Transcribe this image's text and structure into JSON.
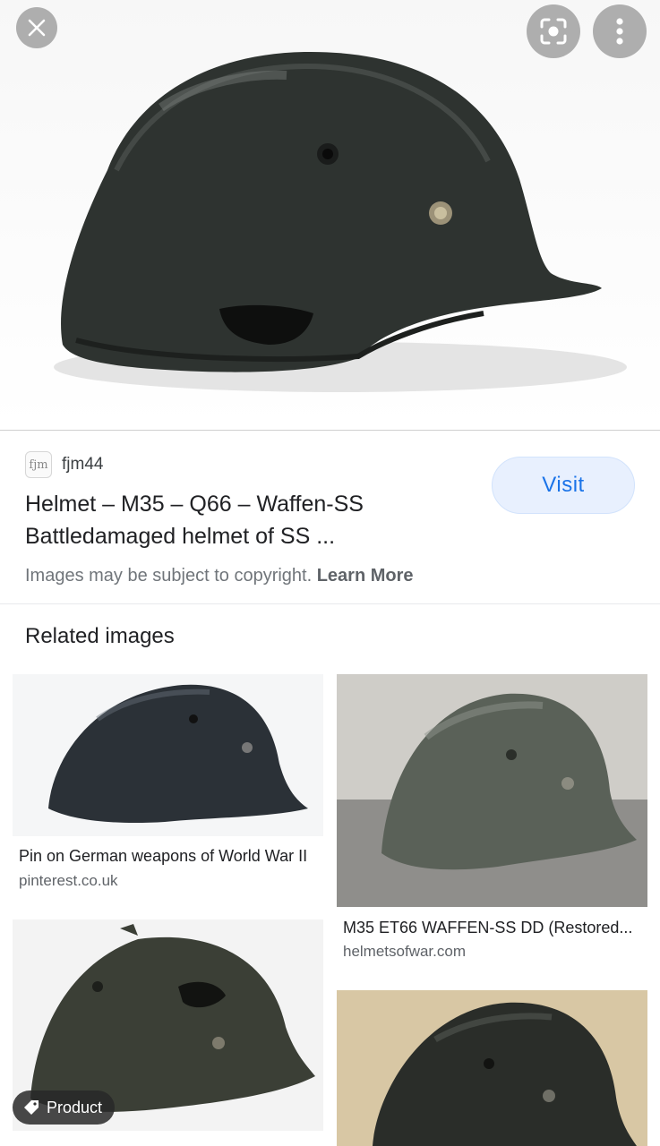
{
  "hero": {
    "colors": {
      "background": "#f7f7f7",
      "helmet": "#2e3330"
    }
  },
  "toolbar": {
    "close_icon": "close-icon",
    "lens_icon": "lens-icon",
    "more_icon": "more-vertical-icon"
  },
  "result": {
    "favicon_text": "fjm",
    "source": "fjm44",
    "title_line1": "Helmet – M35 – Q66 – Waffen-SS",
    "title_line2": "Battledamaged helmet of SS ...",
    "visit_label": "Visit",
    "copyright_text": "Images may be subject to copyright.",
    "learn_more": "Learn More"
  },
  "related": {
    "heading": "Related images",
    "items": [
      {
        "caption": "Pin on German weapons of World War II",
        "domain": "pinterest.co.uk"
      },
      {
        "caption": "M35 ET66 WAFFEN-SS DD (Restored...",
        "domain": "helmetsofwar.com"
      },
      {
        "badge": "Product"
      },
      {}
    ]
  },
  "colors": {
    "accent": "#1a73e8",
    "visit_bg": "#e8f0fe"
  }
}
